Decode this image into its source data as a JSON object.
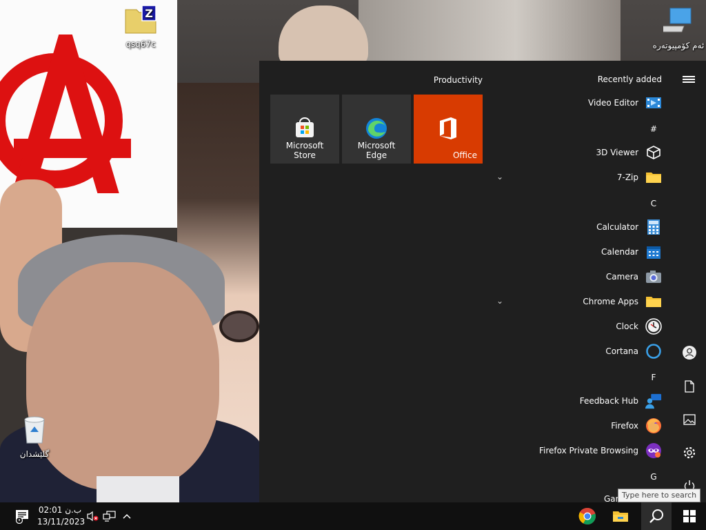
{
  "desktop": {
    "icons": [
      {
        "label": "qsq67c",
        "icon": "zip-folder-icon"
      },
      {
        "label": "ئەم کۆمپیوتەرە",
        "icon": "this-pc-icon"
      },
      {
        "label": "گلێشدان",
        "icon": "recycle-bin-icon"
      }
    ]
  },
  "start_menu": {
    "tiles_group_title": "Productivity",
    "tiles": [
      {
        "label": "Microsoft Store",
        "icon": "microsoft-store-icon"
      },
      {
        "label": "Microsoft Edge",
        "icon": "edge-icon"
      },
      {
        "label": "Office",
        "icon": "office-icon"
      }
    ],
    "list_header": "Recently added",
    "apps": [
      {
        "label": "Video Editor",
        "icon": "video-editor-icon"
      },
      {
        "label": "3D Viewer",
        "icon": "cube-icon"
      },
      {
        "label": "7-Zip",
        "icon": "folder-icon"
      },
      {
        "label": "Calculator",
        "icon": "calculator-icon"
      },
      {
        "label": "Calendar",
        "icon": "calendar-icon"
      },
      {
        "label": "Camera",
        "icon": "camera-icon"
      },
      {
        "label": "Chrome Apps",
        "icon": "folder-icon"
      },
      {
        "label": "Clock",
        "icon": "clock-icon"
      },
      {
        "label": "Cortana",
        "icon": "cortana-icon"
      },
      {
        "label": "Feedback Hub",
        "icon": "feedback-hub-icon"
      },
      {
        "label": "Firefox",
        "icon": "firefox-icon"
      },
      {
        "label": "Firefox Private Browsing",
        "icon": "firefox-private-icon"
      },
      {
        "label": "Gam",
        "icon": ""
      }
    ],
    "letters": [
      "#",
      "C",
      "F",
      "G"
    ]
  },
  "taskbar": {
    "time": "02:01 ب.ن",
    "date": "13/11/2023",
    "search_tooltip": "Type here to search"
  },
  "colors": {
    "start_bg": "#1f1f1f",
    "tile_bg": "#333333",
    "office_accent": "#d83b01",
    "taskbar_bg": "#101010"
  }
}
